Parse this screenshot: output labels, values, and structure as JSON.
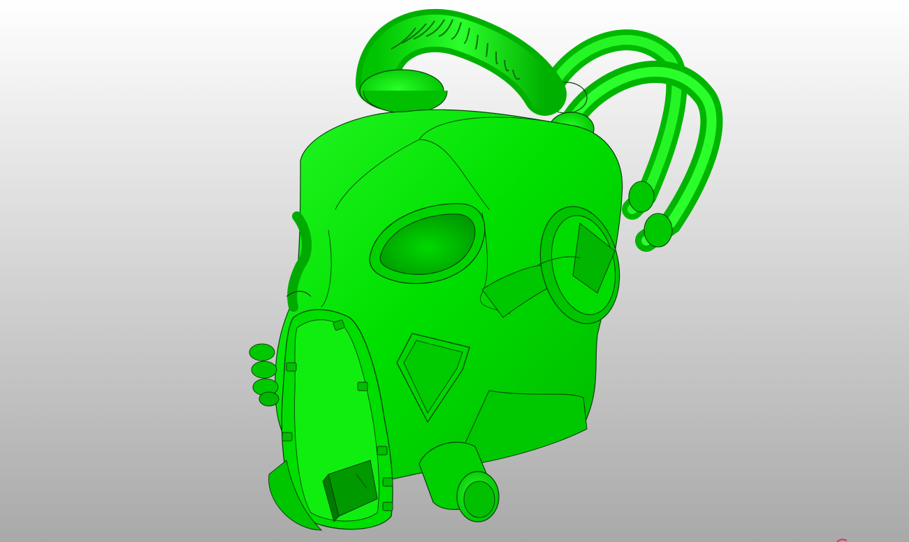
{
  "viewport": {
    "background_top": "#ffffff",
    "background_bottom": "#a9a9a9",
    "model_color": "#00e600",
    "model_highlight": "#2bff2b",
    "model_shadow": "#00a800",
    "model_deep_shadow": "#006f00",
    "edge_color": "#0b3d0b",
    "corner_marker_color": "#d2385a"
  },
  "model": {
    "name": "gas-mask-helmet",
    "render_mode": "shaded-with-edges"
  }
}
